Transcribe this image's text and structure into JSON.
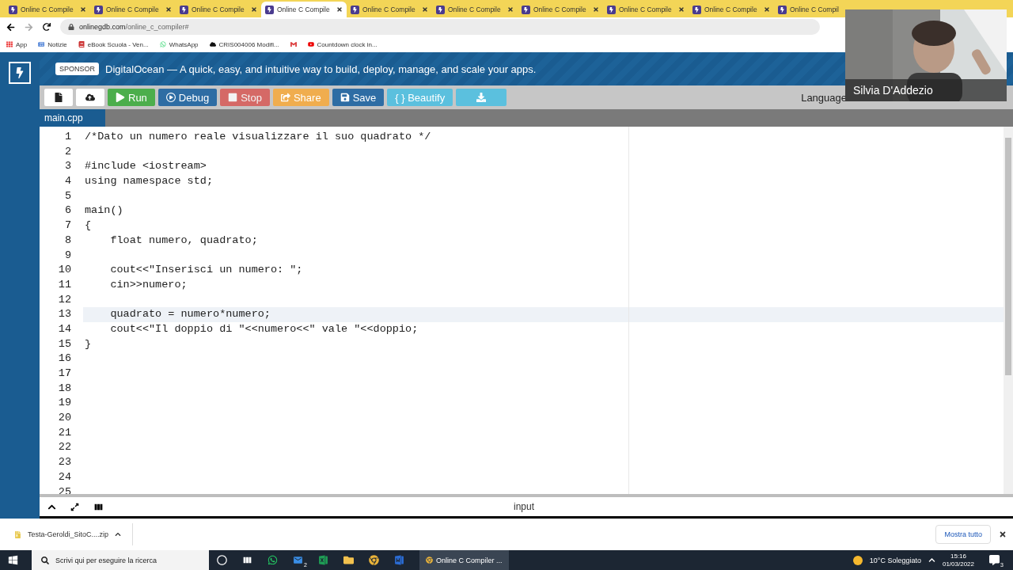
{
  "browser_tabs": [
    {
      "title": "Online C Compile",
      "selected": false
    },
    {
      "title": "Online C Compile",
      "selected": false
    },
    {
      "title": "Online C Compile",
      "selected": false
    },
    {
      "title": "Online C Compile",
      "selected": true
    },
    {
      "title": "Online C Compile",
      "selected": false
    },
    {
      "title": "Online C Compile",
      "selected": false
    },
    {
      "title": "Online C Compile",
      "selected": false
    },
    {
      "title": "Online C Compile",
      "selected": false
    },
    {
      "title": "Online C Compile",
      "selected": false
    },
    {
      "title": "Online C Compil",
      "selected": false
    }
  ],
  "address": {
    "host": "onlinegdb.com",
    "path": "/online_c_compiler#"
  },
  "bookmarks": [
    {
      "label": "App",
      "kind": "apps"
    },
    {
      "label": "Notizie",
      "kind": "news"
    },
    {
      "label": "eBook Scuola - Ven...",
      "kind": "book"
    },
    {
      "label": "WhatsApp",
      "kind": "chat"
    },
    {
      "label": "CRIS004006 Modifi...",
      "kind": "cloud"
    },
    {
      "kind": "mail"
    },
    {
      "label": "Countdown clock in...",
      "kind": "video"
    }
  ],
  "sponsor": {
    "badge": "SPONSOR",
    "text": "DigitalOcean — A quick, easy, and intuitive way to build, deploy, manage, and scale your apps."
  },
  "toolbar": [
    {
      "kind": "new"
    },
    {
      "kind": "upload"
    },
    {
      "kind": "run",
      "label": "Run"
    },
    {
      "kind": "debug",
      "label": "Debug"
    },
    {
      "kind": "stop",
      "label": "Stop"
    },
    {
      "kind": "share",
      "label": "Share"
    },
    {
      "kind": "save",
      "label": "Save"
    },
    {
      "kind": "beautify",
      "label": "{ } Beautify"
    },
    {
      "kind": "download"
    }
  ],
  "language_label": "Language",
  "file_tab": "main.cpp",
  "code_lines": [
    {
      "number": "1",
      "text": "/*Dato un numero reale visualizzare il suo quadrato */",
      "active": false
    },
    {
      "number": "2",
      "active": false
    },
    {
      "number": "3",
      "text": "#include <iostream>",
      "active": false
    },
    {
      "number": "4",
      "text": "using namespace std;",
      "active": false
    },
    {
      "number": "5",
      "active": false
    },
    {
      "number": "6",
      "text": "main()",
      "active": false
    },
    {
      "number": "7",
      "text": "{",
      "active": false
    },
    {
      "number": "8",
      "text": "    float numero, quadrato;",
      "active": false
    },
    {
      "number": "9",
      "active": false
    },
    {
      "number": "10",
      "text": "    cout<<\"Inserisci un numero: \";",
      "active": false
    },
    {
      "number": "11",
      "text": "    cin>>numero;",
      "active": false
    },
    {
      "number": "12",
      "active": false
    },
    {
      "number": "13",
      "text": "    quadrato = numero*numero;",
      "active": true
    },
    {
      "number": "14",
      "text": "    cout<<\"Il doppio di \"<<numero<<\" vale \"<<doppio;",
      "active": false
    },
    {
      "number": "15",
      "text": "}",
      "active": false
    },
    {
      "number": "16",
      "active": false
    },
    {
      "number": "17",
      "active": false
    },
    {
      "number": "18",
      "active": false
    },
    {
      "number": "19",
      "active": false
    },
    {
      "number": "20",
      "active": false
    },
    {
      "number": "21",
      "active": false
    },
    {
      "number": "22",
      "active": false
    },
    {
      "number": "23",
      "active": false
    },
    {
      "number": "24",
      "active": false
    },
    {
      "number": "25",
      "active": false
    }
  ],
  "io_label": "input",
  "download": {
    "file": "Testa-Geroldi_SitoC....zip",
    "show_all": "Mostra tutto"
  },
  "taskbar": {
    "search": "Scrivi qui per eseguire la ricerca",
    "mail_badge": "2",
    "window": "Online C Compiler ...",
    "weather": "10°C  Soleggiato",
    "time": "15:16",
    "date": "01/03/2022",
    "notifications": "3"
  },
  "webcam": {
    "name": "Silvia D'Addezio"
  }
}
